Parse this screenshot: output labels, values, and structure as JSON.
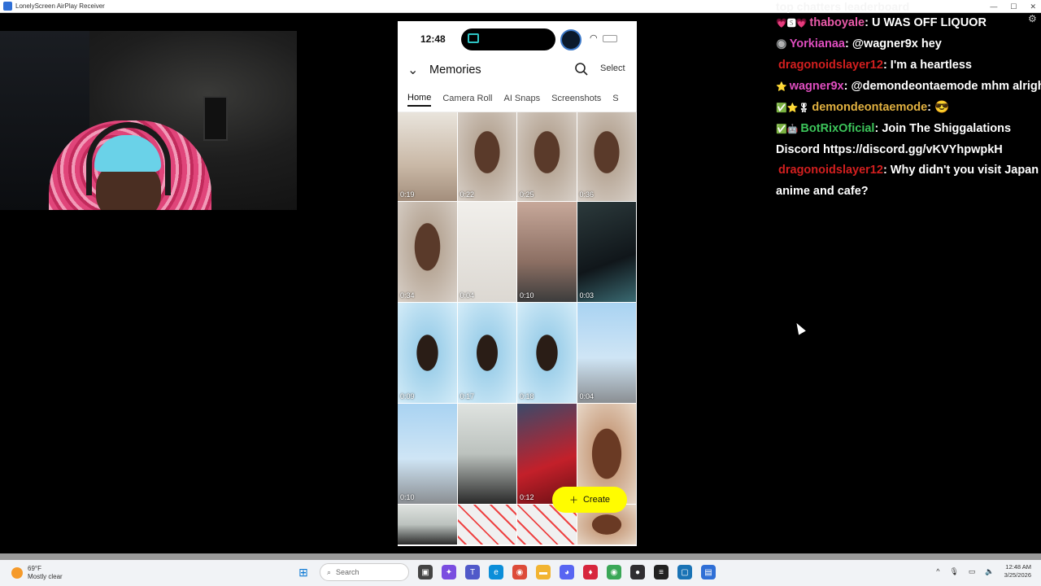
{
  "window": {
    "title": "LonelyScreen AirPlay Receiver",
    "controls": [
      "—",
      "☐",
      "✕"
    ]
  },
  "phone": {
    "status_time": "12:48",
    "header_title": "Memories",
    "select_label": "Select",
    "tabs": [
      {
        "label": "Home",
        "active": true
      },
      {
        "label": "Camera Roll",
        "active": false
      },
      {
        "label": "AI Snaps",
        "active": false
      },
      {
        "label": "Screenshots",
        "active": false
      },
      {
        "label": "S",
        "active": false
      }
    ],
    "grid": [
      {
        "duration": "0:19",
        "style": "c-room"
      },
      {
        "duration": "0:22",
        "style": "c-face"
      },
      {
        "duration": "0:25",
        "style": "c-face"
      },
      {
        "duration": "0:36",
        "style": "c-face"
      },
      {
        "duration": "0:34",
        "style": "c-face"
      },
      {
        "duration": "0:04",
        "style": "c-wall"
      },
      {
        "duration": "0:10",
        "style": "c-legs"
      },
      {
        "duration": "0:03",
        "style": "c-dark"
      },
      {
        "duration": "0:09",
        "style": "c-car"
      },
      {
        "duration": "0:17",
        "style": "c-car"
      },
      {
        "duration": "0:18",
        "style": "c-car"
      },
      {
        "duration": "0:04",
        "style": "c-sky"
      },
      {
        "duration": "0:10",
        "style": "c-sky"
      },
      {
        "duration": "",
        "style": "c-gym"
      },
      {
        "duration": "0:12",
        "style": "c-red"
      },
      {
        "duration": "",
        "style": "c-selfie"
      },
      {
        "duration": "",
        "style": "c-gym"
      },
      {
        "duration": "",
        "style": "c-paper"
      },
      {
        "duration": "",
        "style": "c-paper"
      },
      {
        "duration": "",
        "style": "c-selfie"
      }
    ],
    "create_label": "Create"
  },
  "chat": {
    "leaderboard_title": "top chatters leaderboard",
    "messages": [
      {
        "badges": "💗🆂💗",
        "user": "thaboyale",
        "user_color": "#e85aa8",
        "text": "U WAS OFF LIQUOR"
      },
      {
        "badges": "🔘",
        "user": "Yorkianaa",
        "user_color": "#e04ec0",
        "text": "@wagner9x hey"
      },
      {
        "badges": "",
        "user": "dragonoidslayer12",
        "user_color": "#d21f1f",
        "text": "I'm a heartless"
      },
      {
        "badges": "⭐",
        "user": "wagner9x",
        "user_color": "#e04ec0",
        "text": "@demondeontaemode mhm alright"
      },
      {
        "badges": "✅⭐🎖",
        "user": "demondeontaemode",
        "user_color": "#e0b040",
        "text": "😎"
      },
      {
        "badges": "✅🤖",
        "user": "BotRixOficial",
        "user_color": "#3cc45a",
        "text": "Join The Shiggalations Discord https://discord.gg/vKVYhpwpkH"
      },
      {
        "badges": "",
        "user": "dragonoidslayer12",
        "user_color": "#d21f1f",
        "text": "Why didn't you visit Japan anime and cafe?"
      }
    ]
  },
  "taskbar": {
    "temperature": "69°F",
    "weather": "Mostly clear",
    "search_placeholder": "Search",
    "time": "12:48 AM",
    "date": "3/25/2026"
  },
  "colors": {
    "snap_yellow": "#fffc00",
    "taskbar_bg": "#f1f3f6"
  }
}
